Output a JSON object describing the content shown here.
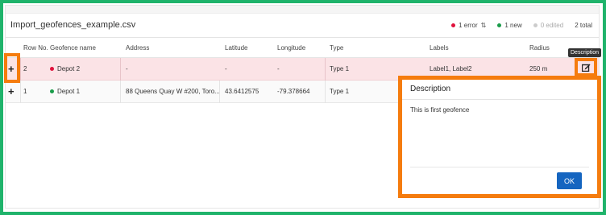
{
  "header": {
    "filename": "Import_geofences_example.csv",
    "errors": "1 error",
    "new": "1 new",
    "edited": "0 edited",
    "total": "2 total",
    "error_color": "#e0123c",
    "new_color": "#1a9c4a",
    "edited_color": "#cccccc"
  },
  "columns": [
    "Row No.",
    "Geofence name",
    "Address",
    "Latitude",
    "Longitude",
    "Type",
    "Labels",
    "Radius"
  ],
  "rows": [
    {
      "expand": "+",
      "row_no": "2",
      "name": "Depot 2",
      "status_color": "#e0123c",
      "address": "-",
      "latitude": "-",
      "longitude": "-",
      "type": "Type 1",
      "labels": "Label1, Label2",
      "radius": "250 m"
    },
    {
      "expand": "+",
      "row_no": "1",
      "name": "Depot 1",
      "status_color": "#1a9c4a",
      "address": "88 Queens Quay W #200, Toro...",
      "latitude": "43.6412575",
      "longitude": "-79.378664",
      "type": "Type 1"
    }
  ],
  "tooltip": "Description",
  "modal": {
    "title": "Description",
    "text": "This is first geofence",
    "ok_label": "OK"
  },
  "icons": {
    "sort": "sort-icon",
    "description": "edit-note-icon"
  }
}
